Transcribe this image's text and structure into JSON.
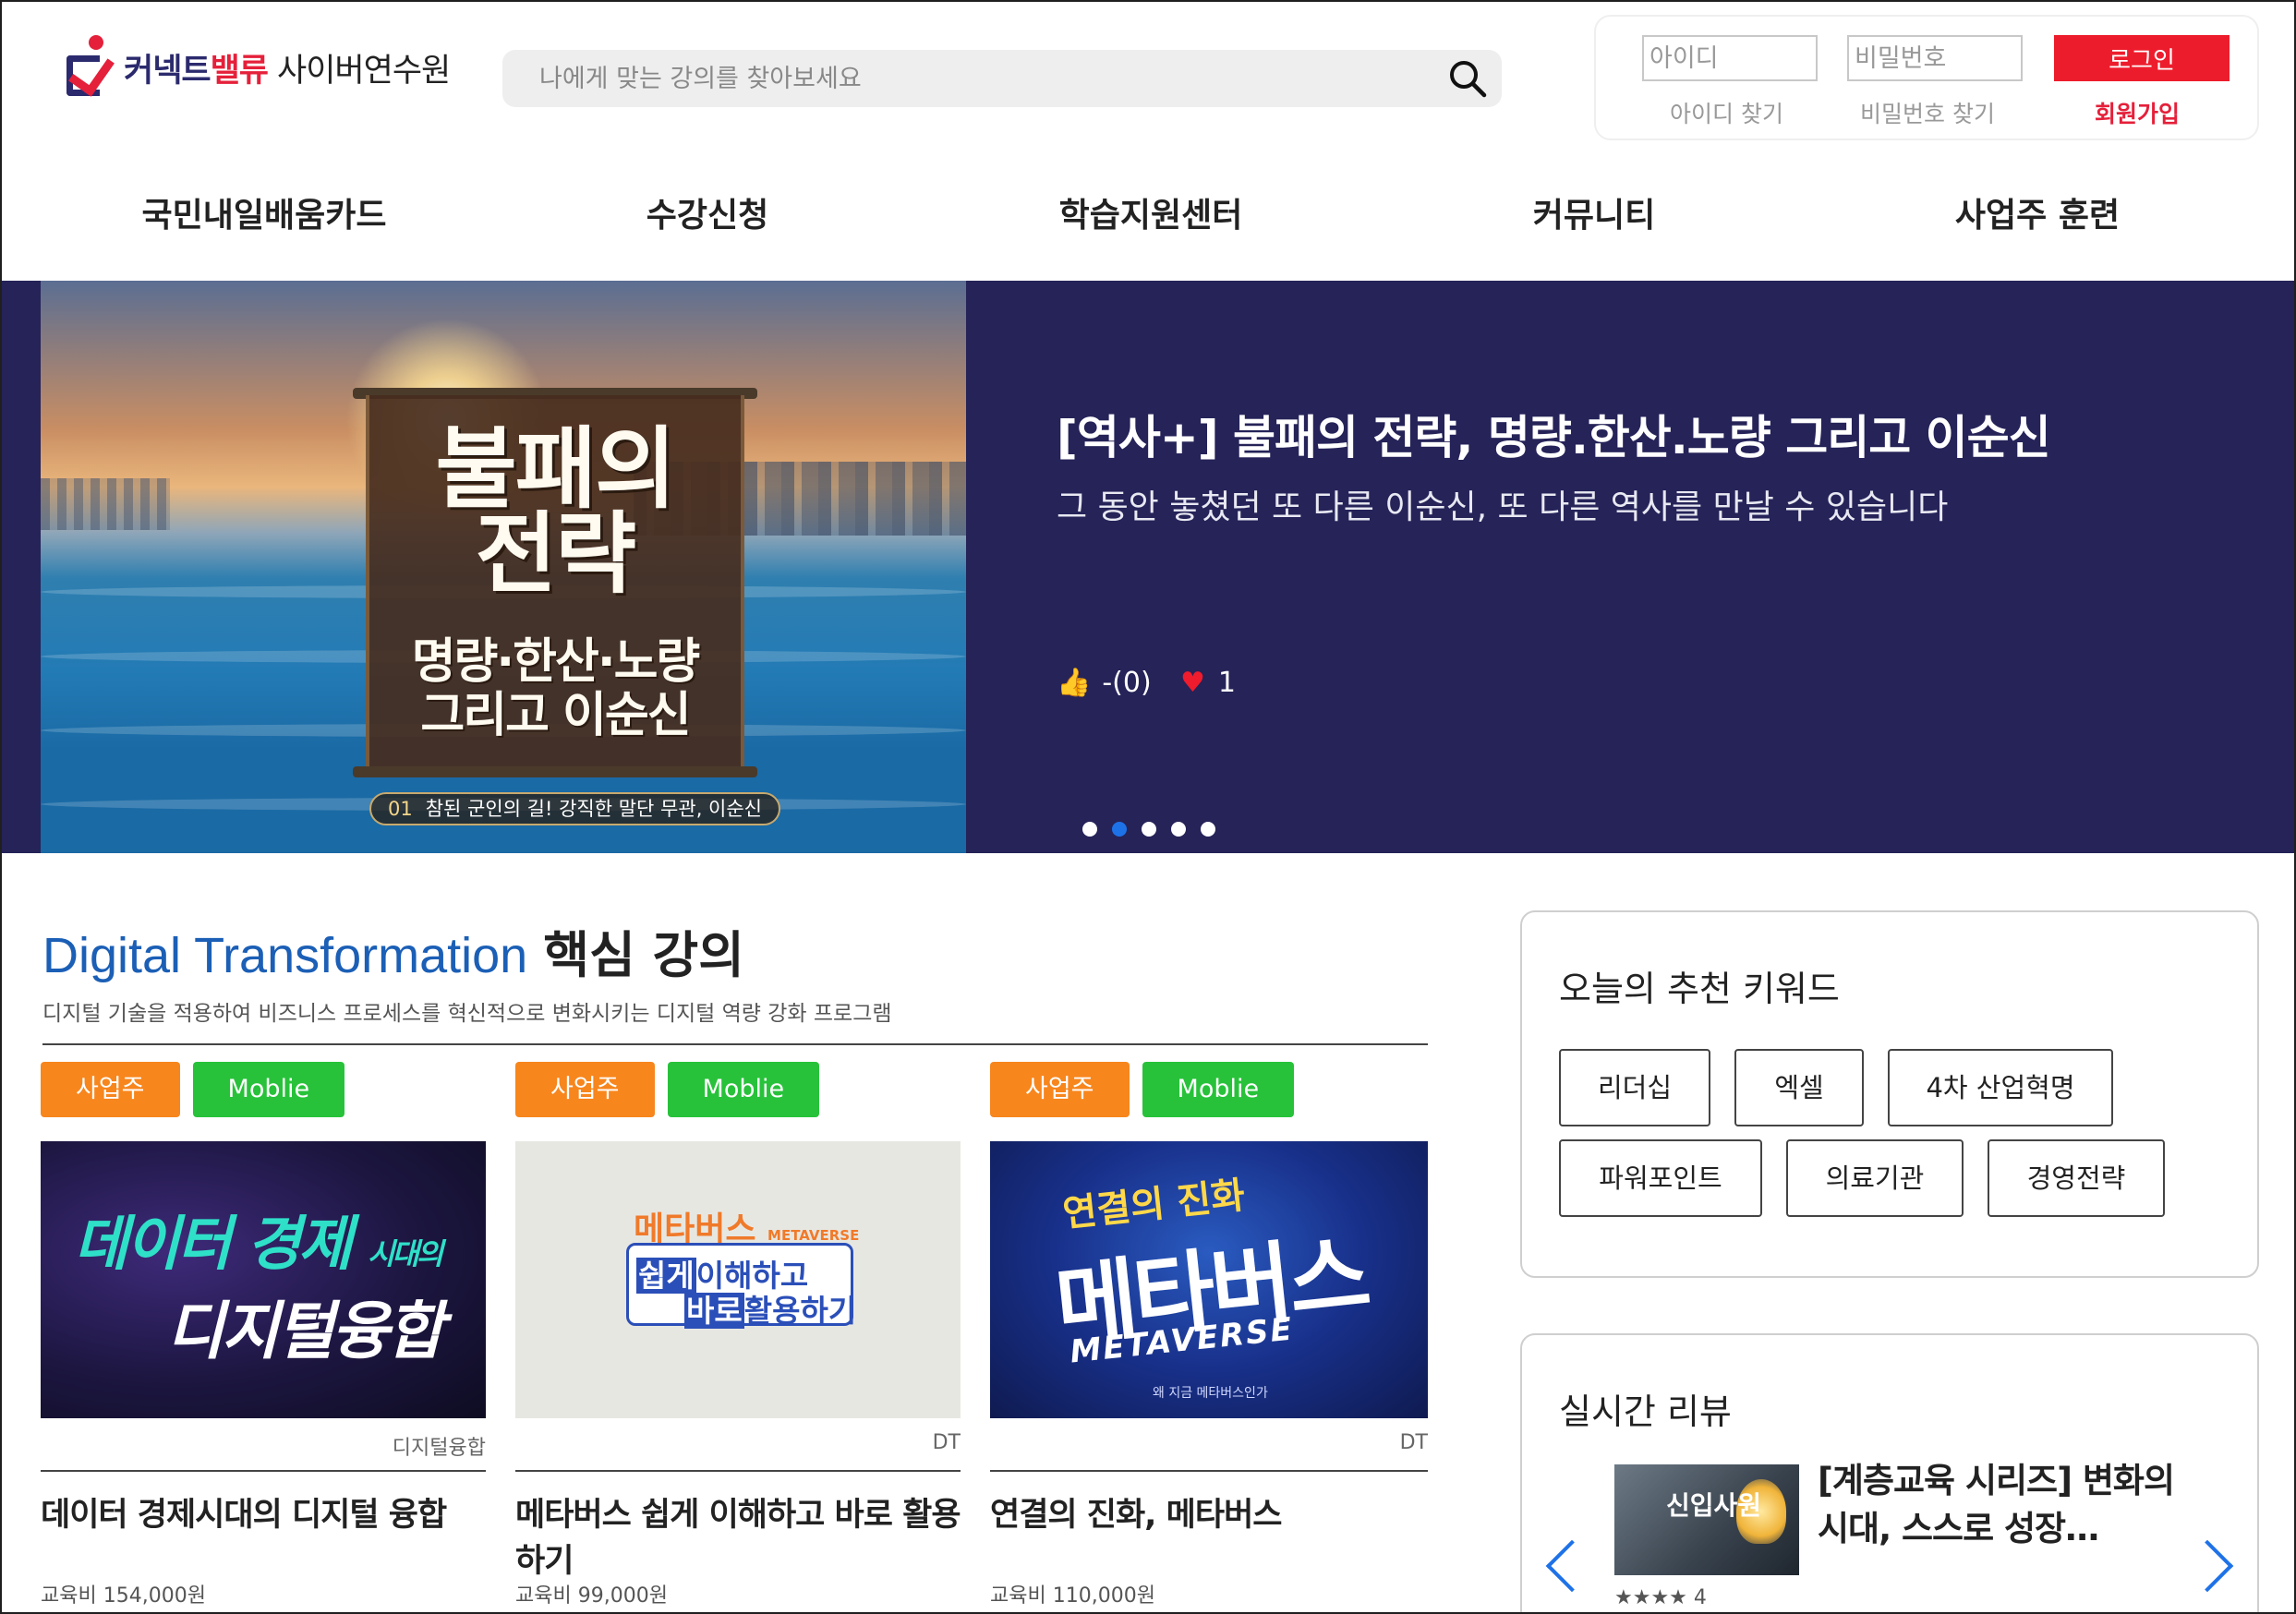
{
  "header": {
    "logo": {
      "brand_a": "커넥트",
      "brand_b": "밸류",
      "brand_sub": "사이버연수원"
    },
    "search": {
      "placeholder": "나에게 맞는 강의를 찾아보세요",
      "icon": "search-icon"
    },
    "login": {
      "id_placeholder": "아이디",
      "pw_placeholder": "비밀번호",
      "login_label": "로그인",
      "find_id": "아이디 찾기",
      "find_pw": "비밀번호 찾기",
      "join": "회원가입"
    }
  },
  "nav": {
    "items": [
      {
        "label": "국민내일배움카드"
      },
      {
        "label": "수강신청"
      },
      {
        "label": "학습지원센터"
      },
      {
        "label": "커뮤니티"
      },
      {
        "label": "사업주 훈련"
      }
    ]
  },
  "hero": {
    "image_title_line1": "불패의",
    "image_title_line2": "전략",
    "image_sub_line1": "명량·한산·노량",
    "image_sub_line2": "그리고 이순신",
    "episode_no": "01",
    "episode_text": "참된 군인의 길! 강직한 말단 무관, 이순신",
    "title": "[역사+] 불패의 전략, 명량.한산.노량 그리고 이순신",
    "subtitle": "그 동안 놓쳤던 또 다른 이순신, 또 다른 역사를 만날 수 있습니다",
    "like_icon": "thumbs-up-icon",
    "like_text": "-(0)",
    "heart_icon": "heart-icon",
    "heart_count": "1",
    "slide_count": 5,
    "active_slide": 2
  },
  "dt_section": {
    "title_accent": "Digital Transformation",
    "title_rest": "핵심 강의",
    "description": "디지털 기술을 적용하여 비즈니스 프로세스를 혁신적으로 변화시키는 디지털 역량 강화 프로그램",
    "courses": [
      {
        "tags": [
          "사업주",
          "Moblie"
        ],
        "thumb_line1": "데이터 경제",
        "thumb_line1_small": "시대의",
        "thumb_line2": "디지털융합",
        "category": "디지털융합",
        "title": "데이터 경제시대의 디지털 융합",
        "price": "교육비 154,000원"
      },
      {
        "tags": [
          "사업주",
          "Moblie"
        ],
        "thumb_line1": "메타버스",
        "thumb_line1_small": "METAVERSE",
        "thumb_box1_hl": "쉽게",
        "thumb_box1": "이해하고",
        "thumb_box2_hl": "바로",
        "thumb_box2": "활용하기",
        "category": "DT",
        "title": "메타버스 쉽게 이해하고 바로 활용하기",
        "price": "교육비 99,000원"
      },
      {
        "tags": [
          "사업주",
          "Moblie"
        ],
        "thumb_line1": "연결의 진화",
        "thumb_line2": "메타버스",
        "thumb_line3": "METAVERSE",
        "thumb_line4": "왜 지금 메타버스인가",
        "category": "DT",
        "title": "연결의 진화, 메타버스",
        "price": "교육비 110,000원"
      }
    ]
  },
  "keywords": {
    "title": "오늘의 추천 키워드",
    "items": [
      "리더십",
      "엑셀",
      "4차 산업혁명",
      "파워포인트",
      "의료기관",
      "경영전략"
    ]
  },
  "review": {
    "title": "실시간 리뷰",
    "thumb_text": "신입사원",
    "item_title": "[계층교육 시리즈] 변화의 시대, 스스로 성장…",
    "stars": "★★★★ 4"
  },
  "colors": {
    "brand_navy": "#2b2a6e",
    "brand_red": "#e5203a",
    "hero_bg": "#252358",
    "accent_blue": "#1b5fb6",
    "tag_orange": "#f7861d",
    "tag_green": "#27c23a"
  }
}
